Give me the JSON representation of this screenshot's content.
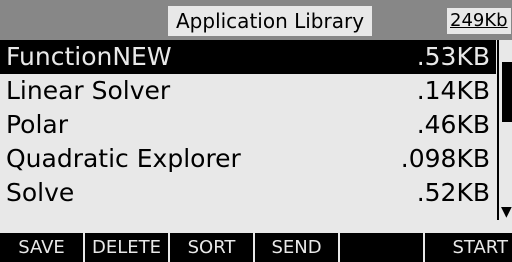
{
  "header": {
    "title": "Application Library",
    "memory": "249Kb"
  },
  "apps": [
    {
      "name": "FunctionNEW",
      "size": ".53KB",
      "selected": true
    },
    {
      "name": "Linear Solver",
      "size": ".14KB",
      "selected": false
    },
    {
      "name": "Polar",
      "size": ".46KB",
      "selected": false
    },
    {
      "name": "Quadratic Explorer",
      "size": ".098KB",
      "selected": false
    },
    {
      "name": "Solve",
      "size": ".52KB",
      "selected": false
    }
  ],
  "softkeys": [
    "SAVE",
    "DELETE",
    "SORT",
    "SEND",
    "",
    "START"
  ],
  "colors": {
    "title_bar": "#878787",
    "background": "#e8e8e8",
    "selection": "#000000"
  }
}
